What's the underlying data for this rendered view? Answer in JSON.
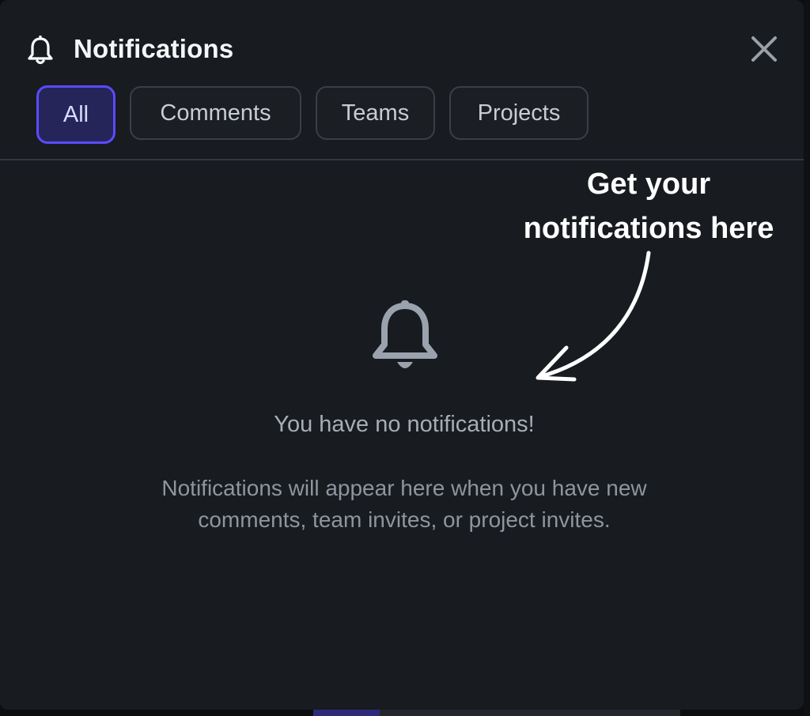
{
  "header": {
    "title": "Notifications",
    "bell_icon": "bell-icon",
    "close_icon": "close-icon"
  },
  "tabs": [
    {
      "label": "All",
      "active": true
    },
    {
      "label": "Comments",
      "active": false
    },
    {
      "label": "Teams",
      "active": false
    },
    {
      "label": "Projects",
      "active": false
    }
  ],
  "empty_state": {
    "icon": "bell-icon",
    "title": "You have no notifications!",
    "description_line1": "Notifications will appear here when you have new",
    "description_line2": "comments, team invites, or project invites."
  },
  "annotation": {
    "line1": "Get your",
    "line2": "notifications here",
    "arrow_icon": "curved-arrow-icon"
  },
  "colors": {
    "background": "#181b20",
    "accent": "#5a4bff",
    "active_tab_bg": "#25255a",
    "text_primary": "#f5f6f8",
    "text_muted": "#a8adb5"
  }
}
